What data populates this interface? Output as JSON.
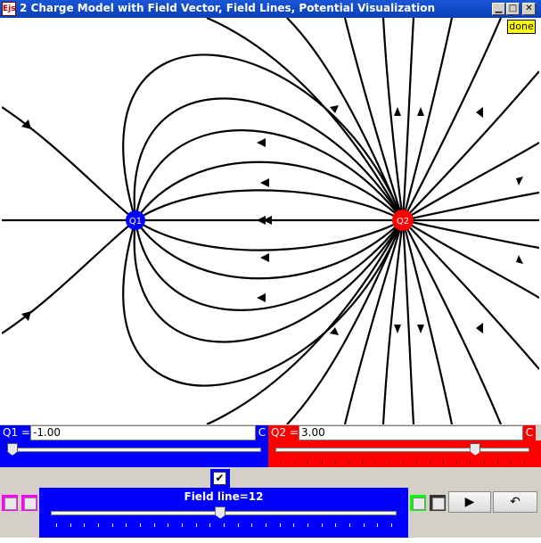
{
  "window": {
    "title": "2 Charge Model with Field Vector, Field Lines, Potential Visualization",
    "app_icon": "Ejs",
    "min_glyph": "▁",
    "max_glyph": "□",
    "close_glyph": "✕"
  },
  "plot": {
    "done_label": "done",
    "charge1": {
      "label": "Q1",
      "color": "#0000ff"
    },
    "charge2": {
      "label": "Q2",
      "color": "#ff0000"
    }
  },
  "controls": {
    "q1": {
      "label": "Q1 =",
      "value": "-1.00",
      "tail": "C",
      "color": "#0000ff",
      "slider_fraction": 0.0
    },
    "q2": {
      "label": "Q2 =",
      "value": "3.00",
      "tail": "C",
      "color": "#ff0000",
      "slider_fraction": 0.8
    },
    "show_check": "✔",
    "field_line": {
      "label": "Field line=12",
      "slider_fraction": 0.49
    },
    "play_glyph": "▶",
    "reset_glyph": "↶",
    "colors": {
      "magenta": "#ff00ff",
      "green": "#00ff00",
      "blue": "#0000ff"
    }
  }
}
